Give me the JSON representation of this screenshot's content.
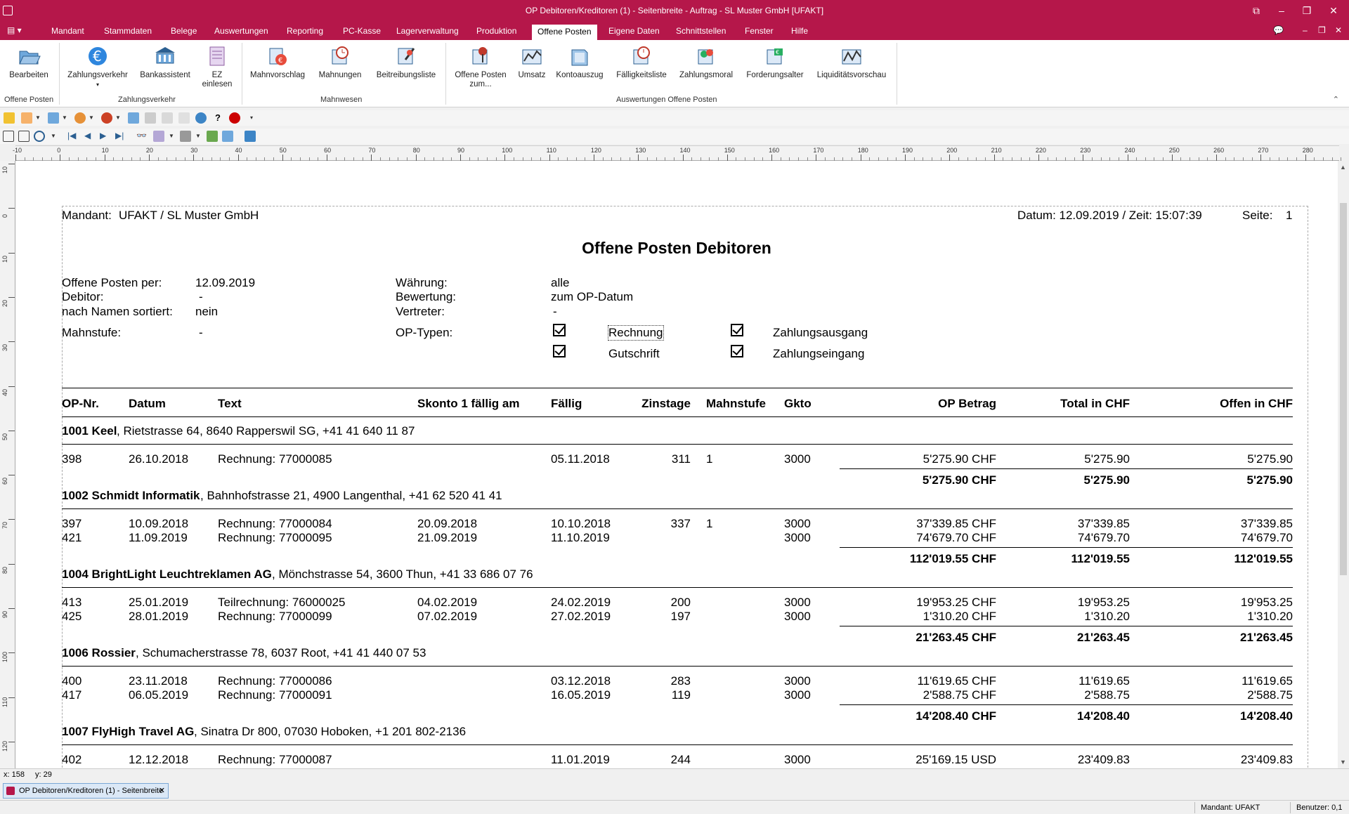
{
  "window": {
    "title": "OP Debitoren/Kreditoren (1) - Seitenbreite - Auftrag - SL Muster GmbH [UFAKT]"
  },
  "menu": {
    "items": [
      "Mandant",
      "Stammdaten",
      "Belege",
      "Auswertungen",
      "Reporting",
      "PC-Kasse",
      "Lagerverwaltung",
      "Produktion",
      "Offene Posten",
      "Eigene Daten",
      "Schnittstellen",
      "Fenster",
      "Hilfe"
    ],
    "active": "Offene Posten"
  },
  "ribbon": {
    "groups": [
      {
        "label": "Offene Posten"
      },
      {
        "label": "Zahlungsverkehr"
      },
      {
        "label": "Mahnwesen"
      },
      {
        "label": "Auswertungen Offene Posten"
      }
    ],
    "buttons": [
      {
        "label": "Bearbeiten",
        "icon": "folder-open-icon"
      },
      {
        "label": "Zahlungsverkehr",
        "icon": "euro-icon"
      },
      {
        "label": "Bankassistent",
        "icon": "bank-icon"
      },
      {
        "label": "EZ",
        "label2": "einlesen",
        "icon": "document-scan-icon"
      },
      {
        "label": "Mahnvorschlag",
        "icon": "reminder-proposal-icon"
      },
      {
        "label": "Mahnungen",
        "icon": "reminder-clock-icon"
      },
      {
        "label": "Beitreibungsliste",
        "icon": "collection-list-icon"
      },
      {
        "label": "Offene Posten",
        "label2": "zum...",
        "icon": "open-items-pin-icon"
      },
      {
        "label": "Umsatz",
        "icon": "revenue-chart-icon"
      },
      {
        "label": "Kontoauszug",
        "icon": "account-statement-icon"
      },
      {
        "label": "Fälligkeitsliste",
        "icon": "due-list-icon"
      },
      {
        "label": "Zahlungsmoral",
        "icon": "payment-morale-icon"
      },
      {
        "label": "Forderungsalter",
        "icon": "receivables-age-icon"
      },
      {
        "label": "Liquiditätsvorschau",
        "icon": "liquidity-preview-icon"
      }
    ]
  },
  "ruler": {
    "h_ticks": [
      "-10",
      "0",
      "10",
      "20",
      "30",
      "40",
      "50",
      "60",
      "70",
      "80",
      "90",
      "100",
      "110",
      "120",
      "130",
      "140",
      "150",
      "160",
      "170",
      "180",
      "190",
      "200",
      "210",
      "220",
      "230",
      "240",
      "250",
      "260",
      "270",
      "280"
    ],
    "v_ticks": [
      "10",
      "0",
      "10",
      "20",
      "30",
      "40",
      "50",
      "60",
      "70",
      "80",
      "90",
      "100",
      "110",
      "120"
    ]
  },
  "report": {
    "mandant_label": "Mandant:",
    "mandant_value": "UFAKT / SL Muster GmbH",
    "date_time": "Datum: 12.09.2019 / Zeit: 15:07:39",
    "page_label": "Seite:",
    "page_value": "1",
    "title": "Offene Posten Debitoren",
    "params": {
      "op_per_label": "Offene Posten per:",
      "op_per_value": "12.09.2019",
      "debitor_label": "Debitor:",
      "debitor_value": "-",
      "sorted_label": "nach Namen sortiert:",
      "sorted_value": "nein",
      "mahnstufe_label": "Mahnstufe:",
      "mahnstufe_value": "-",
      "waehrung_label": "Währung:",
      "waehrung_value": "alle",
      "bewertung_label": "Bewertung:",
      "bewertung_value": "zum OP-Datum",
      "vertreter_label": "Vertreter:",
      "vertreter_value": "-",
      "optypen_label": "OP-Typen:",
      "types": [
        {
          "label": "Rechnung",
          "checked": true
        },
        {
          "label": "Zahlungsausgang",
          "checked": true
        },
        {
          "label": "Gutschrift",
          "checked": true
        },
        {
          "label": "Zahlungseingang",
          "checked": true
        }
      ]
    },
    "columns": [
      "OP-Nr.",
      "Datum",
      "Text",
      "Skonto 1 fällig am",
      "Fällig",
      "Zinstage",
      "Mahnstufe",
      "Gkto",
      "OP Betrag",
      "Total in CHF",
      "Offen in CHF"
    ],
    "customers": [
      {
        "name": "1001 Keel",
        "address": ", Rietstrasse 64, 8640 Rapperswil SG, +41 41 640 11 87",
        "rows": [
          {
            "op": "398",
            "datum": "26.10.2018",
            "text": "Rechnung: 77000085",
            "skonto": "",
            "faellig": "05.11.2018",
            "zinstage": "311",
            "mahnstufe": "1",
            "gkto": "3000",
            "betrag": "5'275.90 CHF",
            "total": "5'275.90",
            "offen": "5'275.90"
          }
        ],
        "sum": {
          "betrag": "5'275.90 CHF",
          "total": "5'275.90",
          "offen": "5'275.90"
        }
      },
      {
        "name": "1002 Schmidt Informatik",
        "address": ", Bahnhofstrasse 21, 4900 Langenthal, +41 62 520 41 41",
        "rows": [
          {
            "op": "397",
            "datum": "10.09.2018",
            "text": "Rechnung: 77000084",
            "skonto": "20.09.2018",
            "faellig": "10.10.2018",
            "zinstage": "337",
            "mahnstufe": "1",
            "gkto": "3000",
            "betrag": "37'339.85 CHF",
            "total": "37'339.85",
            "offen": "37'339.85"
          },
          {
            "op": "421",
            "datum": "11.09.2019",
            "text": "Rechnung: 77000095",
            "skonto": "21.09.2019",
            "faellig": "11.10.2019",
            "zinstage": "",
            "mahnstufe": "",
            "gkto": "3000",
            "betrag": "74'679.70 CHF",
            "total": "74'679.70",
            "offen": "74'679.70"
          }
        ],
        "sum": {
          "betrag": "112'019.55 CHF",
          "total": "112'019.55",
          "offen": "112'019.55"
        }
      },
      {
        "name": "1004 BrightLight Leuchtreklamen AG",
        "address": ", Mönchstrasse 54, 3600 Thun, +41 33 686 07 76",
        "rows": [
          {
            "op": "413",
            "datum": "25.01.2019",
            "text": "Teilrechnung: 76000025",
            "skonto": "04.02.2019",
            "faellig": "24.02.2019",
            "zinstage": "200",
            "mahnstufe": "",
            "gkto": "3000",
            "betrag": "19'953.25 CHF",
            "total": "19'953.25",
            "offen": "19'953.25"
          },
          {
            "op": "425",
            "datum": "28.01.2019",
            "text": "Rechnung: 77000099",
            "skonto": "07.02.2019",
            "faellig": "27.02.2019",
            "zinstage": "197",
            "mahnstufe": "",
            "gkto": "3000",
            "betrag": "1'310.20 CHF",
            "total": "1'310.20",
            "offen": "1'310.20"
          }
        ],
        "sum": {
          "betrag": "21'263.45 CHF",
          "total": "21'263.45",
          "offen": "21'263.45"
        }
      },
      {
        "name": "1006 Rossier",
        "address": ", Schumacherstrasse 78, 6037 Root, +41 41 440 07 53",
        "rows": [
          {
            "op": "400",
            "datum": "23.11.2018",
            "text": "Rechnung: 77000086",
            "skonto": "",
            "faellig": "03.12.2018",
            "zinstage": "283",
            "mahnstufe": "",
            "gkto": "3000",
            "betrag": "11'619.65 CHF",
            "total": "11'619.65",
            "offen": "11'619.65"
          },
          {
            "op": "417",
            "datum": "06.05.2019",
            "text": "Rechnung: 77000091",
            "skonto": "",
            "faellig": "16.05.2019",
            "zinstage": "119",
            "mahnstufe": "",
            "gkto": "3000",
            "betrag": "2'588.75 CHF",
            "total": "2'588.75",
            "offen": "2'588.75"
          }
        ],
        "sum": {
          "betrag": "14'208.40 CHF",
          "total": "14'208.40",
          "offen": "14'208.40"
        }
      },
      {
        "name": "1007 FlyHigh Travel AG",
        "address": ", Sinatra Dr 800, 07030 Hoboken, +1 201 802-2136",
        "rows": [
          {
            "op": "402",
            "datum": "12.12.2018",
            "text": "Rechnung: 77000087",
            "skonto": "",
            "faellig": "11.01.2019",
            "zinstage": "244",
            "mahnstufe": "",
            "gkto": "3000",
            "betrag": "25'169.15 USD",
            "total": "23'409.83",
            "offen": "23'409.83"
          }
        ],
        "sum": null
      }
    ]
  },
  "coords": {
    "x": "x: 158",
    "y": "y: 29"
  },
  "taskbar": {
    "tab_label": "OP Debitoren/Kreditoren (1) - Seitenbreite",
    "close": "✕"
  },
  "status": {
    "mandant": "Mandant: UFAKT",
    "benutzer": "Benutzer: 0,1"
  },
  "colors": {
    "accent": "#b5174a"
  }
}
